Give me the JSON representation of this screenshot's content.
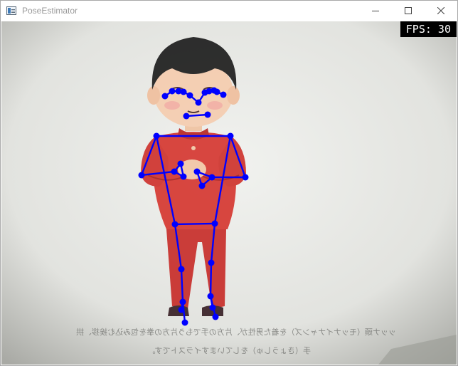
{
  "window": {
    "title": "PoseEstimator",
    "controls": [
      {
        "name": "minimize-button",
        "icon": "minimize-icon"
      },
      {
        "name": "maximize-button",
        "icon": "maximize-icon"
      },
      {
        "name": "close-button",
        "icon": "close-icon"
      }
    ]
  },
  "overlay": {
    "fps_text": "FPS: 30",
    "skeleton_color": "#0000ff"
  },
  "scene": {
    "subject": "cartoon boy in red outfit on paper",
    "caption_lines": [
      "ッッナ頭（モッナイナャンズ）を着た男性が、片方の手でもう片方の拳を包み込む挨拶、拱",
      "手（きょうしゅ）をしていますイラストです。"
    ]
  }
}
